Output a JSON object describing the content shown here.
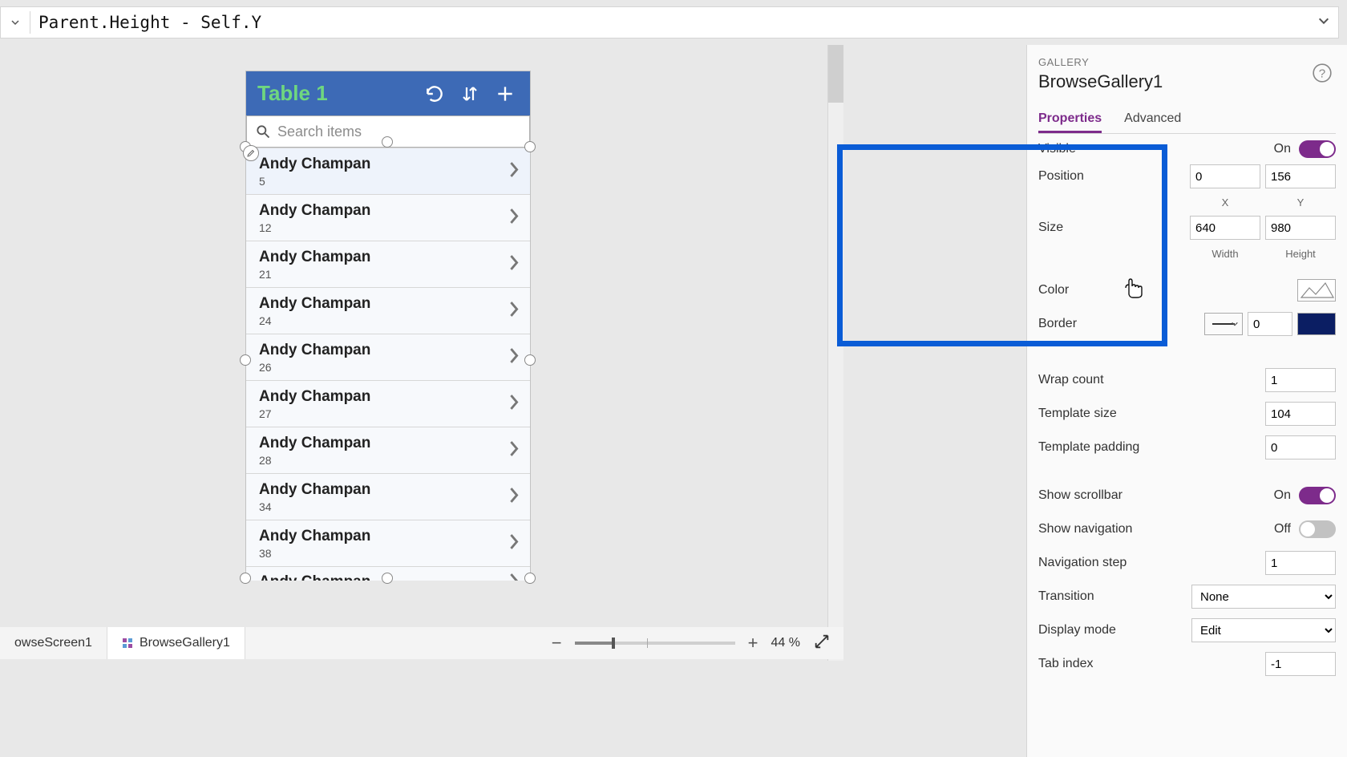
{
  "formula": "Parent.Height - Self.Y",
  "phone": {
    "title": "Table 1",
    "search_placeholder": "Search items",
    "items": [
      {
        "name": "Andy Champan",
        "sub": "5"
      },
      {
        "name": "Andy Champan",
        "sub": "12"
      },
      {
        "name": "Andy Champan",
        "sub": "21"
      },
      {
        "name": "Andy Champan",
        "sub": "24"
      },
      {
        "name": "Andy Champan",
        "sub": "26"
      },
      {
        "name": "Andy Champan",
        "sub": "27"
      },
      {
        "name": "Andy Champan",
        "sub": "28"
      },
      {
        "name": "Andy Champan",
        "sub": "34"
      },
      {
        "name": "Andy Champan",
        "sub": "38"
      },
      {
        "name": "Andy Champan",
        "sub": ""
      }
    ]
  },
  "panel": {
    "kicker": "GALLERY",
    "name": "BrowseGallery1",
    "tabs": {
      "properties": "Properties",
      "advanced": "Advanced"
    },
    "visible": {
      "label": "Visible",
      "state": "On"
    },
    "position": {
      "label": "Position",
      "x": "0",
      "y": "156",
      "xl": "X",
      "yl": "Y"
    },
    "size": {
      "label": "Size",
      "w": "640",
      "h": "980",
      "wl": "Width",
      "hl": "Height"
    },
    "color": {
      "label": "Color",
      "hex": "#ffffff"
    },
    "border": {
      "label": "Border",
      "value": "0",
      "swatch": "#0b1e63"
    },
    "wrap": {
      "label": "Wrap count",
      "value": "1"
    },
    "template_size": {
      "label": "Template size",
      "value": "104"
    },
    "template_padding": {
      "label": "Template padding",
      "value": "0"
    },
    "show_scroll": {
      "label": "Show scrollbar",
      "state": "On"
    },
    "show_nav": {
      "label": "Show navigation",
      "state": "Off"
    },
    "nav_step": {
      "label": "Navigation step",
      "value": "1"
    },
    "transition": {
      "label": "Transition",
      "value": "None"
    },
    "display_mode": {
      "label": "Display mode",
      "value": "Edit"
    },
    "tab_index": {
      "label": "Tab index",
      "value": "-1"
    }
  },
  "breadcrumb": {
    "screen": "owseScreen1",
    "gallery": "BrowseGallery1"
  },
  "zoom": {
    "value": "44",
    "pct": "%"
  }
}
